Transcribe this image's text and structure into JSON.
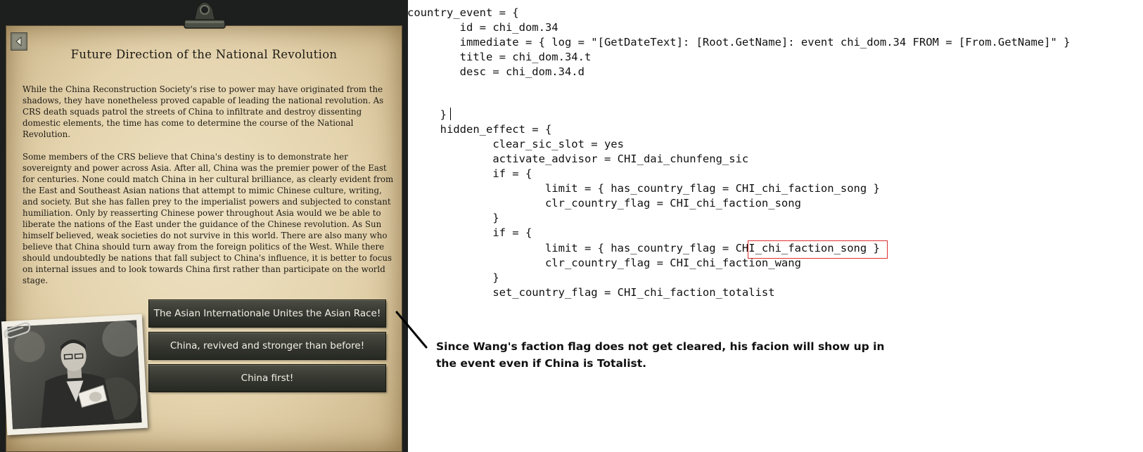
{
  "event": {
    "title": "Future Direction of the National Revolution",
    "description": [
      "While the China Reconstruction Society's rise to power may have originated from the shadows, they have nonetheless proved capable of leading the national revolution. As CRS death squads patrol the streets of China to infiltrate and destroy dissenting domestic elements, the time has come to determine the course of the National Revolution.",
      "Some members of the CRS believe that China's destiny is to demonstrate her sovereignty and power across Asia. After all, China was the premier power of the East for centuries. None could match China in her cultural brilliance, as clearly evident from the East and Southeast Asian nations that attempt to mimic Chinese culture, writing, and society. But she has fallen prey to the imperialist powers and subjected to constant humiliation. Only by reasserting Chinese power throughout Asia would we be able to liberate the nations of the East under the guidance of the Chinese revolution. As Sun himself believed, weak societies do not survive in this world. There are also many who believe that China should turn away from the foreign politics of the West. While there should undoubtedly be nations that fall subject to China's influence, it is better to focus on internal issues and to look towards China first rather than participate on the world stage."
    ],
    "options": [
      "The Asian Internationale Unites the Asian Race!",
      "China, revived and stronger than before!",
      "China first!"
    ],
    "icons": {
      "back": "back-arrow-icon",
      "clip": "clipboard-clip-icon",
      "portrait": "leader-portrait",
      "paperclip": "paperclip-icon"
    }
  },
  "code": {
    "lines": [
      "country_event = {",
      "        id = chi_dom.34",
      "        immediate = { log = \"[GetDateText]: [Root.GetName]: event chi_dom.34 FROM = [From.GetName]\" }",
      "        title = chi_dom.34.t",
      "        desc = chi_dom.34.d",
      "",
      "",
      "     }",
      "     hidden_effect = {",
      "             clear_sic_slot = yes",
      "             activate_advisor = CHI_dai_chunfeng_sic",
      "             if = {",
      "                     limit = { has_country_flag = CHI_chi_faction_song }",
      "                     clr_country_flag = CHI_chi_faction_song",
      "             }",
      "             if = {",
      "                     limit = { has_country_flag = CHI_chi_faction_song }",
      "                     clr_country_flag = CHI_chi_faction_wang",
      "             }",
      "             set_country_flag = CHI_chi_faction_totalist"
    ],
    "highlight_color": "#e03030"
  },
  "annotation": {
    "text": "Since Wang's faction flag does not get cleared, his facion will show up in the event even if China is Totalist."
  },
  "colors": {
    "parchment": "#e4d3ad",
    "frame": "#1d1f1e",
    "button": "#34362f",
    "button_text": "#f3f1e8"
  }
}
